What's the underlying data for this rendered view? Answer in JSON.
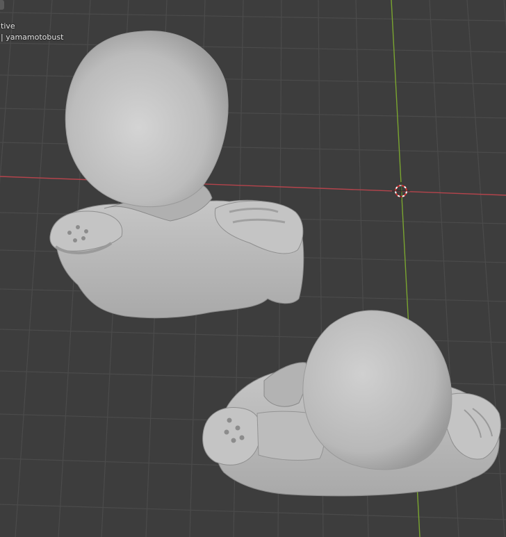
{
  "viewport": {
    "mode_text": "tive",
    "object_text": "| yamamotobust"
  },
  "icons": {
    "cursor": "3d-cursor-icon"
  },
  "colors": {
    "background": "#3d3d3d",
    "grid_minor": "#4a4a4a",
    "grid_major": "#555555",
    "x_axis": "#b5444c",
    "y_axis": "#7aa530",
    "model": "#bdbdbd"
  }
}
